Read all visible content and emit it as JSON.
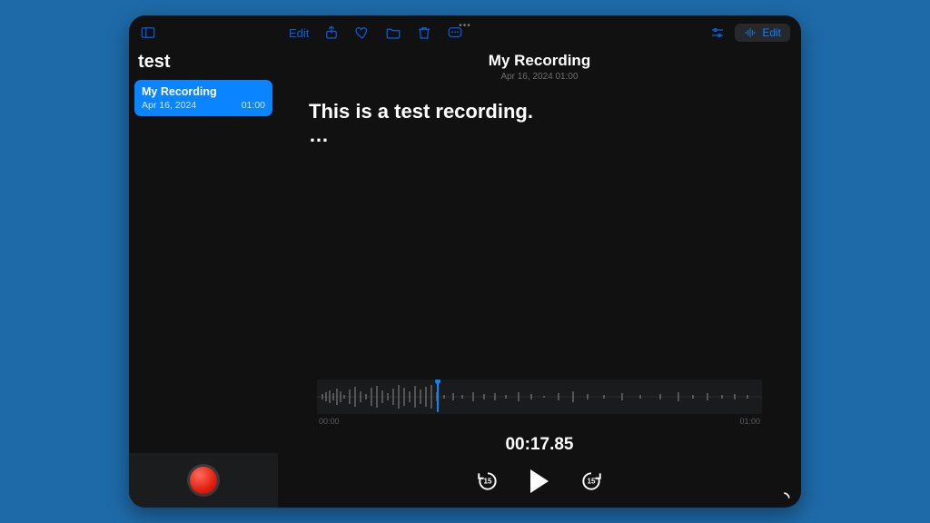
{
  "toolbar": {
    "sidebar_edit": "Edit",
    "right_edit": "Edit"
  },
  "sidebar": {
    "title": "test",
    "items": [
      {
        "title": "My Recording",
        "date": "Apr 16, 2024",
        "duration": "01:00"
      }
    ]
  },
  "main": {
    "title": "My Recording",
    "subtitle": "Apr 16, 2024  01:00",
    "transcript_line": "This is a test recording.",
    "transcript_pending": "…",
    "waveform": {
      "start_label": "00:00",
      "end_label": "01:00",
      "playhead_percent": 27
    },
    "current_time": "00:17.85",
    "skip_seconds": "15"
  }
}
